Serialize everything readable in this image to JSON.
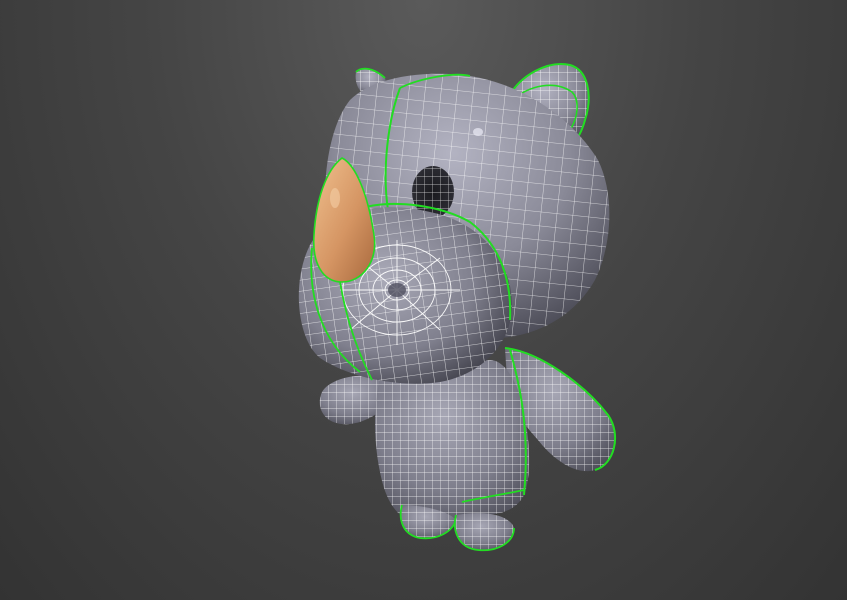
{
  "viewport": {
    "background_top": "#5a5a5a",
    "background_bottom": "#333333"
  },
  "model": {
    "subject": "rhino",
    "body_color": "#8f8f9c",
    "horn_color": "#d99a68",
    "wireframe_color": "#ffffff",
    "seam_color": "#22dd22"
  }
}
